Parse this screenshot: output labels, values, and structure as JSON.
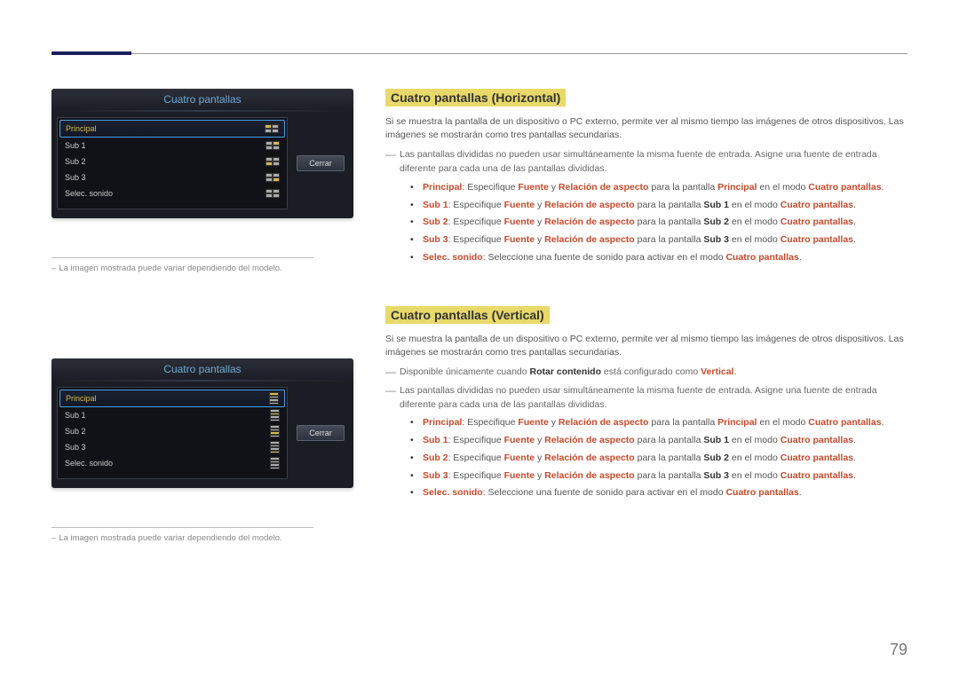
{
  "page_number": "79",
  "left": {
    "ss1": {
      "title": "Cuatro pantallas",
      "rows": [
        "Principal",
        "Sub 1",
        "Sub 2",
        "Sub 3",
        "Selec. sonido"
      ],
      "close": "Cerrar"
    },
    "ss2": {
      "title": "Cuatro pantallas",
      "rows": [
        "Principal",
        "Sub 1",
        "Sub 2",
        "Sub 3",
        "Selec. sonido"
      ],
      "close": "Cerrar"
    },
    "caption": "La imagen mostrada puede variar dependiendo del modelo."
  },
  "right": {
    "section1": {
      "heading": "Cuatro pantallas (Horizontal)",
      "intro": "Si se muestra la pantalla de un dispositivo o PC externo, permite ver al mismo tiempo las imágenes de otros dispositivos. Las imágenes se mostrarán como tres pantallas secundarias.",
      "note1": "Las pantallas divididas no pueden usar simultáneamente la misma fuente de entrada. Asigne una fuente de entrada diferente para cada una de las pantallas divididas.",
      "bullets": [
        {
          "lead": "Principal",
          "tail": ": Especifique ",
          "k1": "Fuente",
          "mid": " y ",
          "k2": "Relación de aspecto",
          "post": " para la pantalla ",
          "target": "Principal",
          "end": " en el modo ",
          "mode": "Cuatro pantallas",
          "dot": "."
        },
        {
          "lead": "Sub 1",
          "tail": ": Especifique ",
          "k1": "Fuente",
          "mid": " y ",
          "k2": "Relación de aspecto",
          "post": " para la pantalla ",
          "target": "Sub 1",
          "end": " en el modo ",
          "mode": "Cuatro pantallas",
          "dot": "."
        },
        {
          "lead": "Sub 2",
          "tail": ": Especifique ",
          "k1": "Fuente",
          "mid": " y ",
          "k2": "Relación de aspecto",
          "post": " para la pantalla ",
          "target": "Sub 2",
          "end": " en el modo ",
          "mode": "Cuatro pantallas",
          "dot": "."
        },
        {
          "lead": "Sub 3",
          "tail": ": Especifique ",
          "k1": "Fuente",
          "mid": " y ",
          "k2": "Relación de aspecto",
          "post": " para la pantalla ",
          "target": "Sub 3",
          "end": " en el modo ",
          "mode": "Cuatro pantallas",
          "dot": "."
        },
        {
          "lead": "Selec. sonido",
          "tail": ": Seleccione una fuente de sonido para activar en el modo ",
          "mode": "Cuatro pantallas",
          "dot": "."
        }
      ]
    },
    "section2": {
      "heading": "Cuatro pantallas (Vertical)",
      "intro": "Si se muestra la pantalla de un dispositivo o PC externo, permite ver al mismo tiempo las imágenes de otros dispositivos. Las imágenes se mostrarán como tres pantallas secundarias.",
      "avail_pre": "Disponible únicamente cuando ",
      "avail_key": "Rotar contenido",
      "avail_mid": " está configurado como ",
      "avail_val": "Vertical",
      "avail_dot": ".",
      "note1": "Las pantallas divididas no pueden usar simultáneamente la misma fuente de entrada. Asigne una fuente de entrada diferente para cada una de las pantallas divididas.",
      "bullets": [
        {
          "lead": "Principal",
          "tail": ": Especifique ",
          "k1": "Fuente",
          "mid": " y ",
          "k2": "Relación de aspecto",
          "post": " para la pantalla ",
          "target": "Principal",
          "end": " en el modo ",
          "mode": "Cuatro pantallas",
          "dot": "."
        },
        {
          "lead": "Sub 1",
          "tail": ": Especifique ",
          "k1": "Fuente",
          "mid": " y ",
          "k2": "Relación de aspecto",
          "post": " para la pantalla ",
          "target": "Sub 1",
          "end": " en el modo ",
          "mode": "Cuatro pantallas",
          "dot": "."
        },
        {
          "lead": "Sub 2",
          "tail": ": Especifique ",
          "k1": "Fuente",
          "mid": " y ",
          "k2": "Relación de aspecto",
          "post": " para la pantalla ",
          "target": "Sub 2",
          "end": " en el modo ",
          "mode": "Cuatro pantallas",
          "dot": "."
        },
        {
          "lead": "Sub 3",
          "tail": ": Especifique ",
          "k1": "Fuente",
          "mid": " y ",
          "k2": "Relación de aspecto",
          "post": " para la pantalla ",
          "target": "Sub 3",
          "end": " en el modo ",
          "mode": "Cuatro pantallas",
          "dot": "."
        },
        {
          "lead": "Selec. sonido",
          "tail": ": Seleccione una fuente de sonido para activar en el modo ",
          "mode": "Cuatro pantallas",
          "dot": "."
        }
      ]
    }
  }
}
